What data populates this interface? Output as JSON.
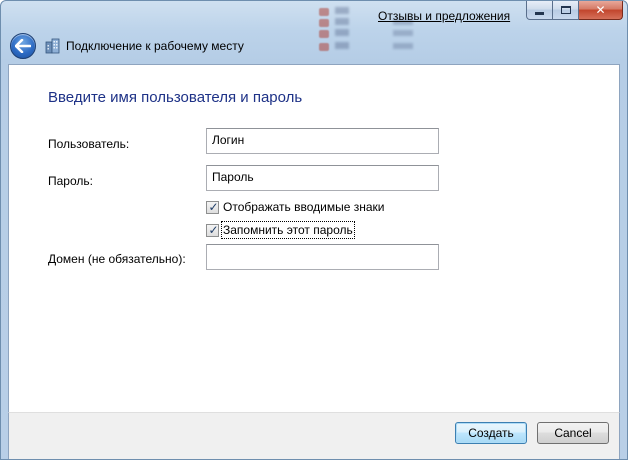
{
  "window": {
    "title": "Подключение к рабочему месту",
    "feedback_link": "Отзывы и предложения",
    "caption_buttons": [
      "minimize",
      "maximize",
      "close"
    ],
    "back_icon": "back-arrow-icon",
    "title_icon": "workplace-network-icon"
  },
  "form": {
    "heading": "Введите имя пользователя и пароль",
    "username": {
      "label": "Пользователь:",
      "value": "Логин"
    },
    "password": {
      "label": "Пароль:",
      "value": "Пароль"
    },
    "show_chars": {
      "label": "Отображать вводимые знаки",
      "checked": true
    },
    "remember": {
      "label": "Запомнить этот пароль",
      "checked": true
    },
    "domain": {
      "label": "Домен (не обязательно):",
      "value": ""
    }
  },
  "footer": {
    "create_label": "Создать",
    "cancel_label": "Cancel"
  },
  "colors": {
    "heading": "#1e3287",
    "glass": "#bcd3ea",
    "close_button": "#c2452c"
  }
}
